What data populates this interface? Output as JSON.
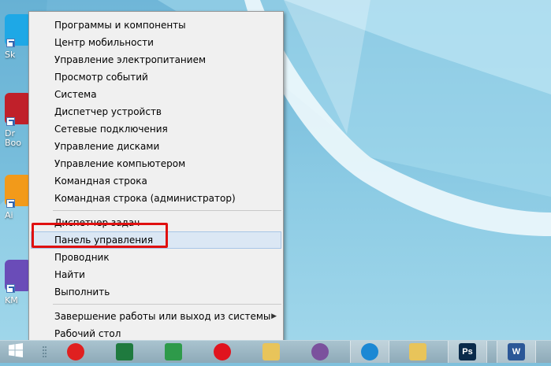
{
  "desktop": {
    "icons": [
      {
        "label": "Sk",
        "icon": "skype-icon",
        "color": "#1ea8e6"
      },
      {
        "label": "Dr",
        "label2": "Boo",
        "icon": "driver-booster-icon",
        "color": "#c0202a"
      },
      {
        "label": "Ai",
        "icon": "aimp-icon",
        "color": "#f29a1a"
      },
      {
        "label": "KM",
        "icon": "kmplayer-icon",
        "color": "#6a4cb8"
      }
    ]
  },
  "menu": {
    "groups": [
      [
        {
          "label": "Программы и компоненты"
        },
        {
          "label": "Центр мобильности"
        },
        {
          "label": "Управление электропитанием"
        },
        {
          "label": "Просмотр событий"
        },
        {
          "label": "Система"
        },
        {
          "label": "Диспетчер устройств"
        },
        {
          "label": "Сетевые подключения"
        },
        {
          "label": "Управление дисками"
        },
        {
          "label": "Управление компьютером"
        },
        {
          "label": "Командная строка"
        },
        {
          "label": "Командная строка (администратор)"
        }
      ],
      [
        {
          "label": "Диспетчер задач"
        },
        {
          "label": "Панель управления",
          "highlighted": true
        },
        {
          "label": "Проводник"
        },
        {
          "label": "Найти"
        },
        {
          "label": "Выполнить"
        }
      ],
      [
        {
          "label": "Завершение работы или выход из системы",
          "submenu": true
        },
        {
          "label": "Рабочий стол"
        }
      ]
    ]
  },
  "taskbar": {
    "start": "windows-start-icon",
    "apps": [
      {
        "name": "yandex-browser-icon",
        "color": "#e02020"
      },
      {
        "name": "excel-icon",
        "color": "#1f7a3e"
      },
      {
        "name": "excel-icon-2",
        "color": "#2e9a4a"
      },
      {
        "name": "opera-icon",
        "color": "#e0141e"
      },
      {
        "name": "file-explorer-icon",
        "color": "#e8c45a"
      },
      {
        "name": "viber-icon",
        "color": "#7b519d"
      },
      {
        "name": "swift-icon",
        "color": "#1c88d4"
      },
      {
        "name": "file-explorer-icon-2",
        "color": "#e8c45a"
      },
      {
        "name": "photoshop-icon",
        "color": "#0a2a4a",
        "text": "Ps"
      },
      {
        "name": "word-icon",
        "color": "#2b5797",
        "text": "W"
      }
    ]
  },
  "colors": {
    "annotation": "#e01010",
    "highlight": "#dbe7f4",
    "menu_bg": "#f0f0f0"
  }
}
